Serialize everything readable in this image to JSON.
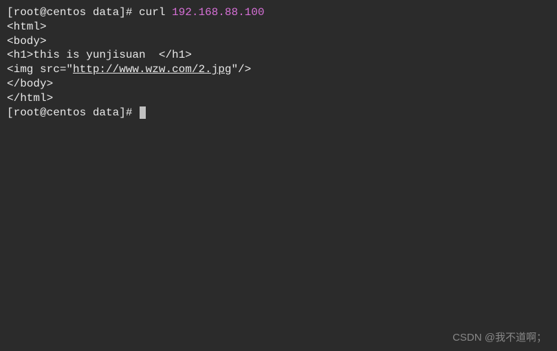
{
  "line1": {
    "prompt": "[root@centos data]# ",
    "command": "curl ",
    "ip": "192.168.88.100"
  },
  "output": {
    "l1": "<html>",
    "l2": "<body>",
    "l3": "<h1>this is yunjisuan  </h1>",
    "l4_pre": "<img src=\"",
    "l4_url": "http://www.wzw.com/2.jpg",
    "l4_post": "\"/>",
    "l5": "</body>",
    "l6": "</html>"
  },
  "line8": {
    "prompt": "[root@centos data]# "
  },
  "watermark_right": "CSDN @我不道啊；",
  "watermark_left": ""
}
